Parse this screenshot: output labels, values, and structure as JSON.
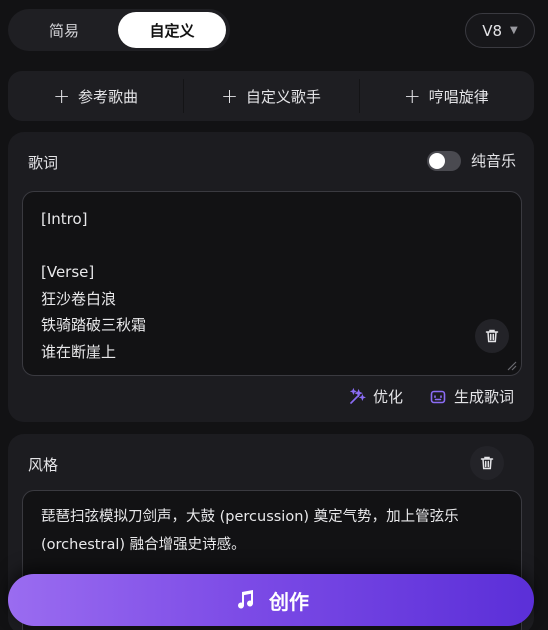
{
  "mode_tabs": {
    "simple": "简易",
    "custom": "自定义",
    "active": "custom"
  },
  "version": {
    "selected": "V8"
  },
  "quick_actions": [
    {
      "label": "参考歌曲",
      "icon": "plus-icon"
    },
    {
      "label": "自定义歌手",
      "icon": "plus-icon"
    },
    {
      "label": "哼唱旋律",
      "icon": "plus-icon"
    }
  ],
  "lyrics": {
    "title": "歌词",
    "pure_music_label": "纯音乐",
    "pure_music_on": false,
    "lines": [
      "[Intro]",
      "",
      "[Verse]",
      "狂沙卷白浪",
      "铁骑踏破三秋霜",
      "谁在断崖上"
    ],
    "optimize_label": "优化",
    "generate_label": "生成歌词"
  },
  "style": {
    "title": "风格",
    "text": "琵琶扫弦模拟刀剑声，大鼓 (percussion) 奠定气势，加上管弦乐 (orchestral) 融合增强史诗感。"
  },
  "create": {
    "label": "创作"
  },
  "colors": {
    "accent_start": "#9a6cf0",
    "accent_end": "#5b2fd8",
    "icon_purple": "#8b6cf5"
  }
}
